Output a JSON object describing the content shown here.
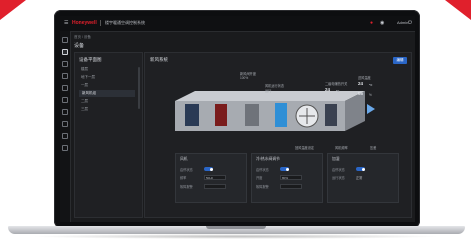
{
  "app": {
    "brand": "Honeywell",
    "title": "楼宇暖通空调控制系统",
    "user": "Admin"
  },
  "breadcrumb": "首页 / 设备",
  "page_title": "设备",
  "tree": {
    "title": "设备平面图",
    "items": [
      {
        "label": "楼层"
      },
      {
        "label": "地下一层"
      },
      {
        "label": "一层"
      },
      {
        "label": "新风机组"
      },
      {
        "label": "二层"
      },
      {
        "label": "三层"
      }
    ]
  },
  "main": {
    "title": "新风系统",
    "button": "编辑",
    "annotations": {
      "filter": {
        "label": "初效过滤",
        "value": "正常"
      },
      "valve": {
        "label": "新风阀开度",
        "value": "100%"
      },
      "chiller": {
        "label": "二级电辅热开关",
        "value": "24",
        "unit": "℃"
      },
      "fan": {
        "label": "风机运行状态",
        "value": "运行"
      },
      "supply_temp": {
        "label": "送风温度",
        "value": "24",
        "unit": "℃"
      },
      "supply_hum": {
        "label": "送风湿度",
        "value": "56",
        "unit": "%"
      },
      "return_temp": {
        "label": "回风温度设定",
        "value": "22"
      },
      "freq": {
        "label": "风机频率",
        "value": "50Hz"
      },
      "pressure": {
        "label": "压差",
        "value": "正常"
      },
      "water_valve": {
        "label": "冷水阀开度",
        "value": "80%"
      }
    },
    "cards": [
      {
        "title": "风机",
        "rows": [
          {
            "label": "启停状态",
            "type": "toggle"
          },
          {
            "label": "频率",
            "type": "input",
            "value": "50Hz"
          },
          {
            "label": "故障报警",
            "type": "text",
            "value": ""
          }
        ]
      },
      {
        "title": "冷/热水阀调节",
        "rows": [
          {
            "label": "启停状态",
            "type": "toggle"
          },
          {
            "label": "开度",
            "type": "input",
            "value": "80%"
          },
          {
            "label": "故障报警",
            "type": "text",
            "value": ""
          }
        ]
      },
      {
        "title": "加湿",
        "rows": [
          {
            "label": "启停状态",
            "type": "toggle"
          },
          {
            "label": "运行状态",
            "type": "text",
            "value": "正常"
          }
        ]
      }
    ]
  },
  "colors": {
    "brand": "#e0202c",
    "accent": "#2a66c7",
    "screen_bg": "#1a1b1d"
  }
}
